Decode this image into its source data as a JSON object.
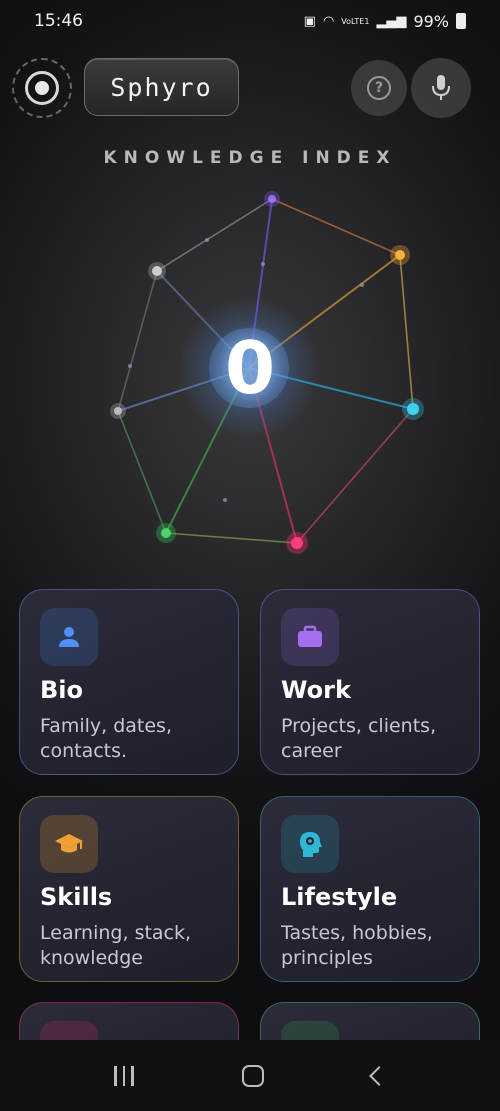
{
  "status_bar": {
    "time": "15:46",
    "battery": "99%",
    "network": "VoLTE1"
  },
  "header": {
    "brand": "Sphyro"
  },
  "knowledge_index": {
    "title": "KNOWLEDGE INDEX",
    "value": "0"
  },
  "categories": [
    {
      "title": "Bio",
      "desc": "Family, dates, contacts.",
      "icon": "person-icon",
      "color": "#4f8ff7"
    },
    {
      "title": "Work",
      "desc": "Projects, clients, career",
      "icon": "briefcase-icon",
      "color": "#a56df0"
    },
    {
      "title": "Skills",
      "desc": "Learning, stack, knowledge",
      "icon": "graduation-cap-icon",
      "color": "#f0a030"
    },
    {
      "title": "Lifestyle",
      "desc": "Tastes, hobbies, principles",
      "icon": "head-gear-icon",
      "color": "#2fb8d6"
    }
  ],
  "colors": {
    "bio": "#4f8ff7",
    "work": "#a56df0",
    "skills": "#f0a030",
    "lifestyle": "#2fb8d6",
    "pink": "#ff2d6f",
    "green": "#3cc45a"
  }
}
